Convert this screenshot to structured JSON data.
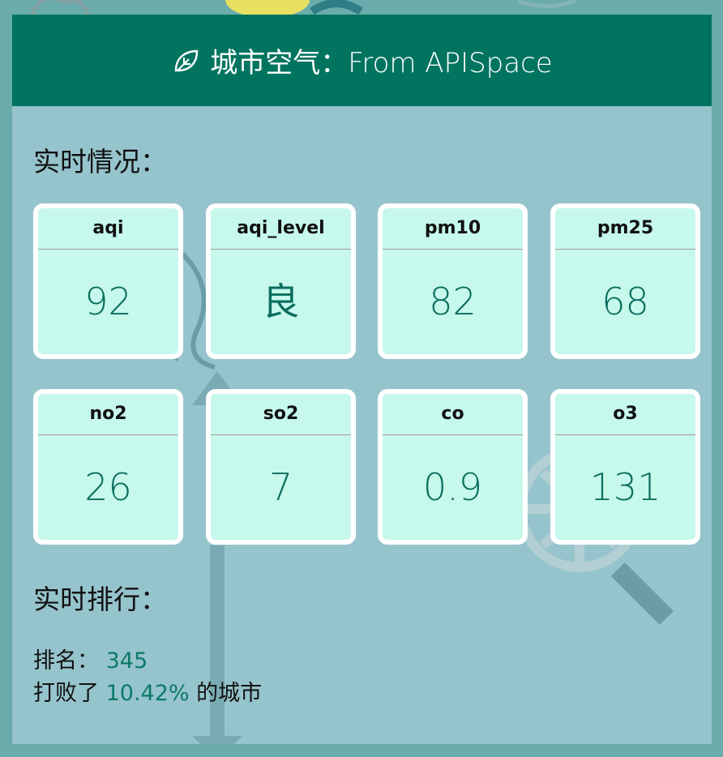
{
  "header": {
    "title": "城市空气：From APISpace",
    "icon": "leaf-icon"
  },
  "realtime": {
    "title": "实时情况：",
    "metrics": [
      {
        "label": "aqi",
        "value": "92"
      },
      {
        "label": "aqi_level",
        "value": "良"
      },
      {
        "label": "pm10",
        "value": "82"
      },
      {
        "label": "pm25",
        "value": "68"
      },
      {
        "label": "no2",
        "value": "26"
      },
      {
        "label": "so2",
        "value": "7"
      },
      {
        "label": "co",
        "value": "0.9"
      },
      {
        "label": "o3",
        "value": "131"
      }
    ]
  },
  "ranking": {
    "title": "实时排行：",
    "rank_label": "排名：",
    "rank_value": "345",
    "beat_prefix": "打败了",
    "beat_value": "10.42%",
    "beat_suffix": "的城市"
  },
  "colors": {
    "header_bg": "#00745f",
    "card_bg": "#96c4cc",
    "tile_bg": "#c6f8ec",
    "value_text": "#0b6e5d"
  }
}
